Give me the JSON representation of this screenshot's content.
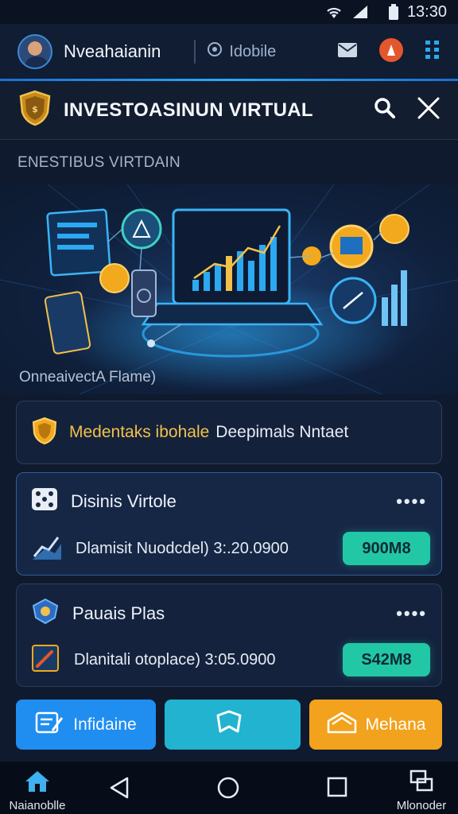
{
  "status_bar": {
    "time": "13:30"
  },
  "header": {
    "username": "Nveahaianin",
    "mode_label": "Idobile"
  },
  "title_bar": {
    "title": "INVESTOASINUN VIRTUAL"
  },
  "section_label": "ENESTIBUS VIRTDAIN",
  "hero": {
    "caption": "OnneaivectA Flame)"
  },
  "promo": {
    "highlight": "Medentaks ibohale",
    "text": "Deepimals Nntaet"
  },
  "accounts": [
    {
      "title": "Disinis Virtole",
      "detail": "Dlamisit Nuodcdel) 3:.20.0900",
      "amount": "900M8"
    },
    {
      "title": "Pauais Plas",
      "detail": "Dlanitali otoplace) 3:05.0900",
      "amount": "S42M8"
    }
  ],
  "actions": [
    {
      "label": "Infidaine"
    },
    {
      "label": ""
    },
    {
      "label": "Mehana"
    }
  ],
  "nav": {
    "home_label": "Naianoblle",
    "right_label": "Mlonoder"
  },
  "colors": {
    "accent": "#1f8ef0",
    "teal": "#22c7a6",
    "orange": "#f3a21d",
    "gold": "#f2c14a",
    "background": "#0f1a2e"
  },
  "icons": {
    "status": [
      "wifi-icon",
      "signal-icon",
      "battery-icon"
    ],
    "header": [
      "mail-icon",
      "profile-badge-icon",
      "grid-menu-icon"
    ],
    "title": [
      "shield-logo-icon",
      "search-icon",
      "close-icon"
    ],
    "nav": [
      "home-icon",
      "back-icon",
      "circle-home-icon",
      "square-recent-icon",
      "switch-icon"
    ]
  }
}
